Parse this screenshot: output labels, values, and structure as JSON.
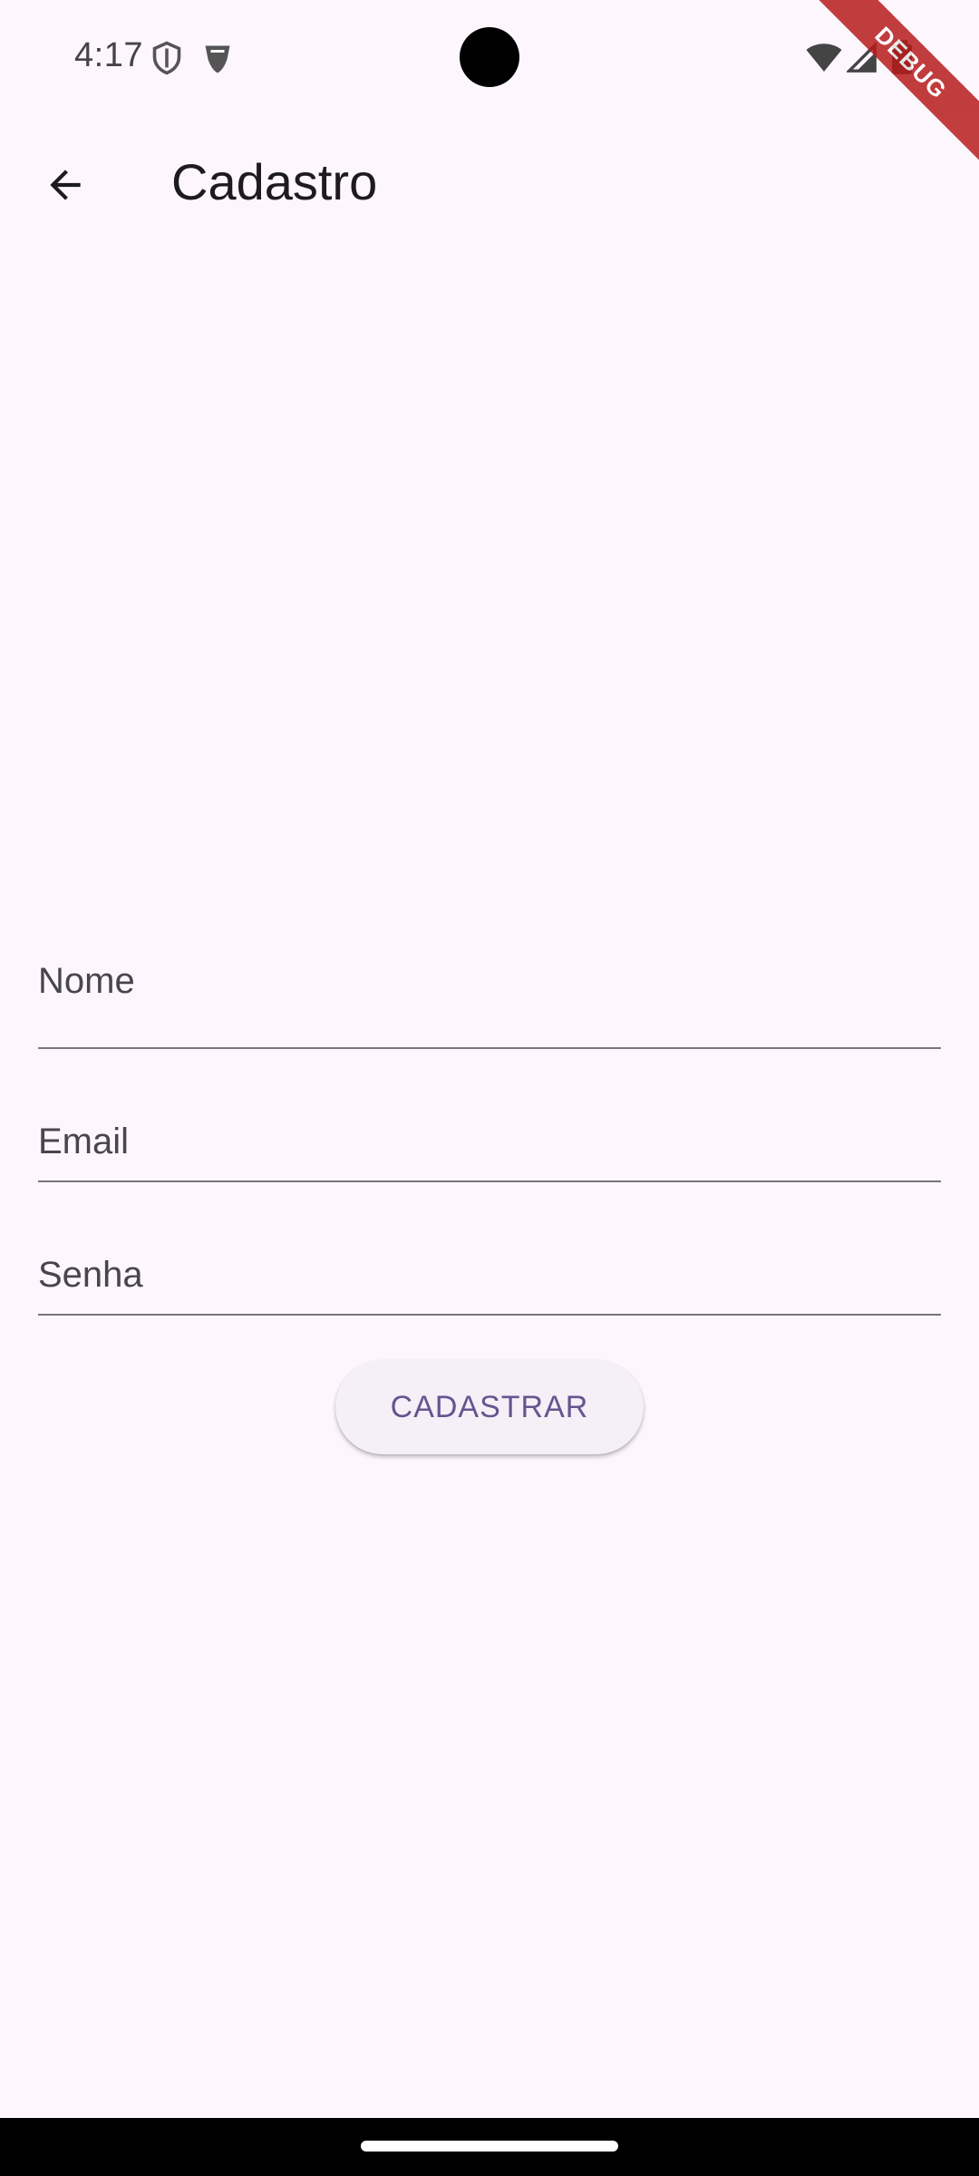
{
  "status_bar": {
    "time": "4:17",
    "icons": [
      "shield-icon",
      "vpn-shield-icon",
      "wifi-icon",
      "signal-icon",
      "battery-icon"
    ]
  },
  "debug_banner": {
    "label": "DEBUG",
    "color": "#b71c1c"
  },
  "app_bar": {
    "back_icon": "arrow-back-icon",
    "title": "Cadastro"
  },
  "form": {
    "name": {
      "placeholder": "Nome",
      "value": ""
    },
    "email": {
      "placeholder": "Email",
      "value": ""
    },
    "password": {
      "placeholder": "Senha",
      "value": ""
    },
    "submit_label": "CADASTRAR"
  },
  "colors": {
    "background": "#fdf7fd",
    "accent": "#65558f",
    "button_bg": "#f5eff7",
    "divider": "#79747e"
  }
}
